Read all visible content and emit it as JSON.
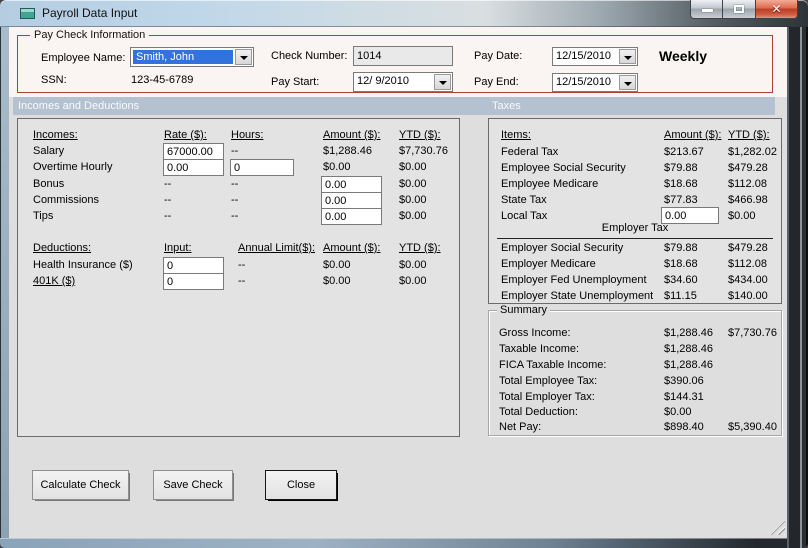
{
  "window": {
    "title": "Payroll Data Input",
    "controls": {
      "minimize": "minimize",
      "maximize": "maximize",
      "close": "close"
    }
  },
  "colors": {
    "groupbox_border": "#a94236",
    "section_band": "#b3c1d1",
    "combo_selection": "#3272dd",
    "close_button_red": "#bb3d26",
    "titlebar_blue": "#c0d7e9"
  },
  "paycheck_info": {
    "legend": "Pay Check Information",
    "employee_name_label": "Employee Name:",
    "employee_name_value": "Smith, John",
    "ssn_label": "SSN:",
    "ssn_value": "123-45-6789",
    "check_number_label": "Check Number:",
    "check_number_value": "1014",
    "pay_start_label": "Pay Start:",
    "pay_start_value": "12/ 9/2010",
    "pay_date_label": "Pay Date:",
    "pay_date_value": "12/15/2010",
    "pay_end_label": "Pay End:",
    "pay_end_value": "12/15/2010",
    "frequency": "Weekly"
  },
  "sections": {
    "incomes_deductions": "Incomes and Deductions",
    "taxes": "Taxes"
  },
  "incomes": {
    "headers": {
      "item": "Incomes:",
      "rate": "Rate ($):",
      "hours": "Hours:",
      "amount": "Amount ($):",
      "ytd": "YTD ($):"
    },
    "rows": [
      {
        "label": "Salary",
        "rate_input": "67000.00",
        "hours": "--",
        "amount": "$1,288.46",
        "ytd": "$7,730.76"
      },
      {
        "label": "Overtime Hourly",
        "rate_input": "0.00",
        "hours_input": "0",
        "amount": "$0.00",
        "ytd": "$0.00"
      },
      {
        "label": "Bonus",
        "rate": "--",
        "hours": "--",
        "amount_input": "0.00",
        "ytd": "$0.00"
      },
      {
        "label": "Commissions",
        "rate": "--",
        "hours": "--",
        "amount_input": "0.00",
        "ytd": "$0.00"
      },
      {
        "label": "Tips",
        "rate": "--",
        "hours": "--",
        "amount_input": "0.00",
        "ytd": "$0.00"
      }
    ]
  },
  "deductions": {
    "headers": {
      "item": "Deductions:",
      "input": "Input:",
      "annual_limit": "Annual Limit($):",
      "amount": "Amount ($):",
      "ytd": "YTD ($):"
    },
    "rows": [
      {
        "label": "Health Insurance  ($)",
        "input": "0",
        "annual_limit": "--",
        "amount": "$0.00",
        "ytd": "$0.00"
      },
      {
        "label": "401K  ($)",
        "input": "0",
        "annual_limit": "--",
        "amount": "$0.00",
        "ytd": "$0.00"
      }
    ]
  },
  "taxes": {
    "headers": {
      "item": "Items:",
      "amount": "Amount ($):",
      "ytd": "YTD ($):"
    },
    "employee_rows": [
      {
        "label": "Federal Tax",
        "amount": "$213.67",
        "ytd": "$1,282.02"
      },
      {
        "label": "Employee Social Security",
        "amount": "$79.88",
        "ytd": "$479.28"
      },
      {
        "label": "Employee Medicare",
        "amount": "$18.68",
        "ytd": "$112.08"
      },
      {
        "label": "State Tax",
        "amount": "$77.83",
        "ytd": "$466.98"
      },
      {
        "label": "Local Tax",
        "amount_input": "0.00",
        "ytd": "$0.00"
      }
    ],
    "employer_header": "Employer Tax",
    "employer_rows": [
      {
        "label": "Employer Social Security",
        "amount": "$79.88",
        "ytd": "$479.28"
      },
      {
        "label": "Employer Medicare",
        "amount": "$18.68",
        "ytd": "$112.08"
      },
      {
        "label": "Employer Fed Unemployment",
        "amount": "$34.60",
        "ytd": "$434.00"
      },
      {
        "label": "Employer State Unemployment",
        "amount": "$11.15",
        "ytd": "$140.00"
      }
    ]
  },
  "summary": {
    "legend": "Summary",
    "rows": [
      {
        "label": "Gross Income:",
        "amount": "$1,288.46",
        "ytd": "$7,730.76"
      },
      {
        "label": "Taxable Income:",
        "amount": "$1,288.46",
        "ytd": ""
      },
      {
        "label": "FICA Taxable Income:",
        "amount": "$1,288.46",
        "ytd": ""
      },
      {
        "label": "Total Employee Tax:",
        "amount": "$390.06",
        "ytd": ""
      },
      {
        "label": "Total Employer Tax:",
        "amount": "$144.31",
        "ytd": ""
      },
      {
        "label": "Total Deduction:",
        "amount": "$0.00",
        "ytd": ""
      },
      {
        "label": "Net Pay:",
        "amount": "$898.40",
        "ytd": "$5,390.40"
      }
    ]
  },
  "buttons": {
    "calculate": "Calculate Check",
    "save": "Save Check",
    "close": "Close"
  }
}
